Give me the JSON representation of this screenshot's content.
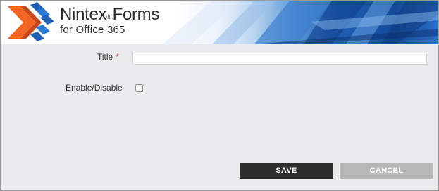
{
  "banner": {
    "brand_name": "Nintex",
    "brand_mark": "®",
    "product_name": "Forms",
    "subtitle": "for Office 365",
    "logo_icon": "nintex-chevron-logo-icon"
  },
  "form": {
    "title_label": "Title",
    "required_marker": "*",
    "title_value": "",
    "enable_label": "Enable/Disable",
    "enable_checked": false
  },
  "actions": {
    "save_label": "SAVE",
    "cancel_label": "CANCEL"
  },
  "colors": {
    "save_bg": "#2e2e2e",
    "cancel_bg": "#b7b7b7",
    "required": "#e02424",
    "logo_orange": "#f26522",
    "logo_blue": "#1f5fb4"
  }
}
